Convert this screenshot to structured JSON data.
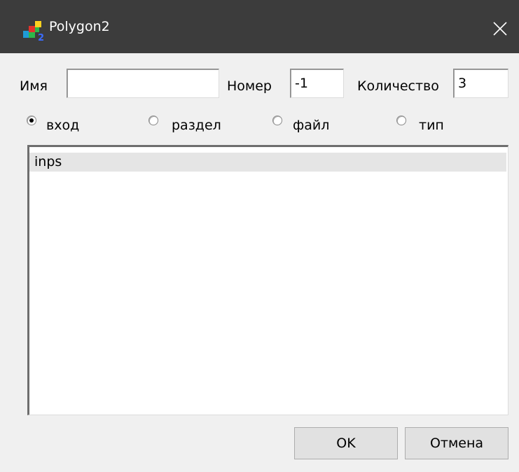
{
  "window": {
    "title": "Polygon2",
    "icon": "polygon2-app-icon",
    "close_icon": "close-icon"
  },
  "fields": {
    "name_label": "Имя",
    "name_value": "",
    "number_label": "Номер",
    "number_value": "-1",
    "count_label": "Количество",
    "count_value": "3"
  },
  "radio_options": [
    {
      "label": "вход",
      "checked": true
    },
    {
      "label": "раздел",
      "checked": false
    },
    {
      "label": "файл",
      "checked": false
    },
    {
      "label": "тип",
      "checked": false
    }
  ],
  "list": {
    "items": [
      "inps"
    ]
  },
  "buttons": {
    "ok": "OK",
    "cancel": "Отмена"
  }
}
